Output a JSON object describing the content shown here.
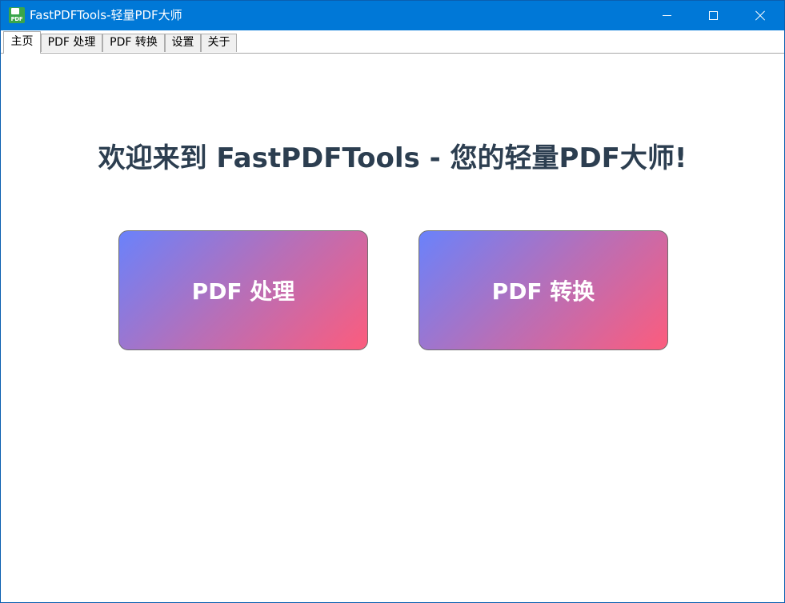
{
  "window": {
    "title": "FastPDFTools-轻量PDF大师",
    "icon_text": "PDF",
    "icon": "app-pdf-icon",
    "controls": [
      "minimize-icon",
      "maximize-icon",
      "close-icon"
    ]
  },
  "tabs": [
    {
      "label": "主页",
      "active": true
    },
    {
      "label": "PDF 处理",
      "active": false
    },
    {
      "label": "PDF 转换",
      "active": false
    },
    {
      "label": "设置",
      "active": false
    },
    {
      "label": "关于",
      "active": false
    }
  ],
  "home": {
    "welcome": "欢迎来到 FastPDFTools - 您的轻量PDF大师!",
    "buttons": [
      {
        "label": "PDF 处理"
      },
      {
        "label": "PDF 转换"
      }
    ]
  },
  "colors": {
    "titlebar": "#0078d7",
    "heading": "#2c3e50",
    "gradient_start": "#6a82fb",
    "gradient_end": "#fc5c7d"
  }
}
